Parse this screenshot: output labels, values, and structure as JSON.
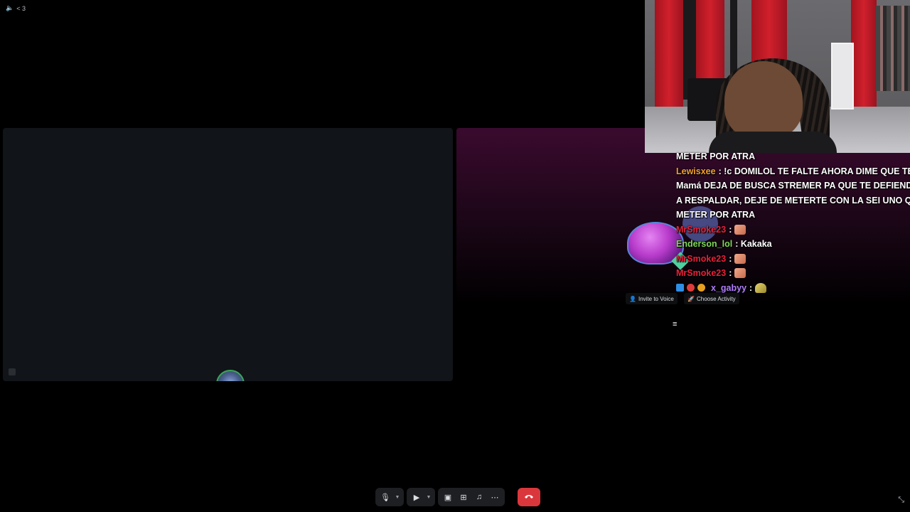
{
  "top_left": {
    "label": "< 3"
  },
  "chat": {
    "lines": [
      {
        "text": "METER POR ATRA"
      },
      {
        "user": "Lewisxee",
        "user_color": "#f0a030",
        "text": ": !c DOMILOL TE FALTE AHORA DIME QUE TE"
      },
      {
        "text": "Mamá DEJA DE BUSCA STREMER PA QUE TE DEFIENDE"
      },
      {
        "text": "A RESPALDAR, DEJE DE METERTE CON LA SEI UNO QUE"
      },
      {
        "text": "METER POR ATRA"
      },
      {
        "user": "MrSmoke23",
        "user_color": "#e8213a",
        "text": ":"
      },
      {
        "user": "Enderson_lol",
        "user_color": "#7ed957",
        "text": ": Kakaka"
      },
      {
        "user": "MrSmoke23",
        "user_color": "#e8213a",
        "text": ":"
      },
      {
        "user": "MrSmoke23",
        "user_color": "#e8213a",
        "text": ":"
      },
      {
        "user": "x_gabyy",
        "user_color": "#b27cff",
        "text": ":"
      }
    ]
  },
  "overlay": {
    "invite_label": "Invite to Voice",
    "activity_label": "Choose Activity"
  },
  "colors": {
    "hangup": "#da373c",
    "speaking_ring": "#3ba55c"
  }
}
